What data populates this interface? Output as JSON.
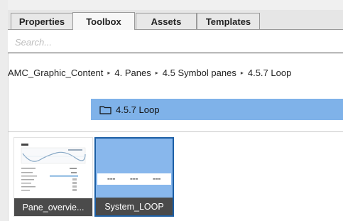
{
  "tabs": [
    {
      "label": "Properties",
      "active": false
    },
    {
      "label": "Toolbox",
      "active": true
    },
    {
      "label": "Assets",
      "active": false
    },
    {
      "label": "Templates",
      "active": false
    }
  ],
  "search": {
    "placeholder": "Search..."
  },
  "breadcrumb": [
    "AMC_Graphic_Content",
    "4. Panes",
    "4.5 Symbol panes",
    "4.5.7 Loop"
  ],
  "breadcrumb_separator": "▸",
  "folder": {
    "label": "4.5.7 Loop",
    "icon": "folder-icon"
  },
  "tiles": [
    {
      "label": "Pane_overvie...",
      "selected": false
    },
    {
      "label": "System_LOOP",
      "selected": true
    }
  ],
  "colors": {
    "selection": "#7fb2e9",
    "selected_tile": "#88b7ec",
    "selected_border": "#1c5fa5",
    "caption_bg": "#4b4b4b"
  }
}
